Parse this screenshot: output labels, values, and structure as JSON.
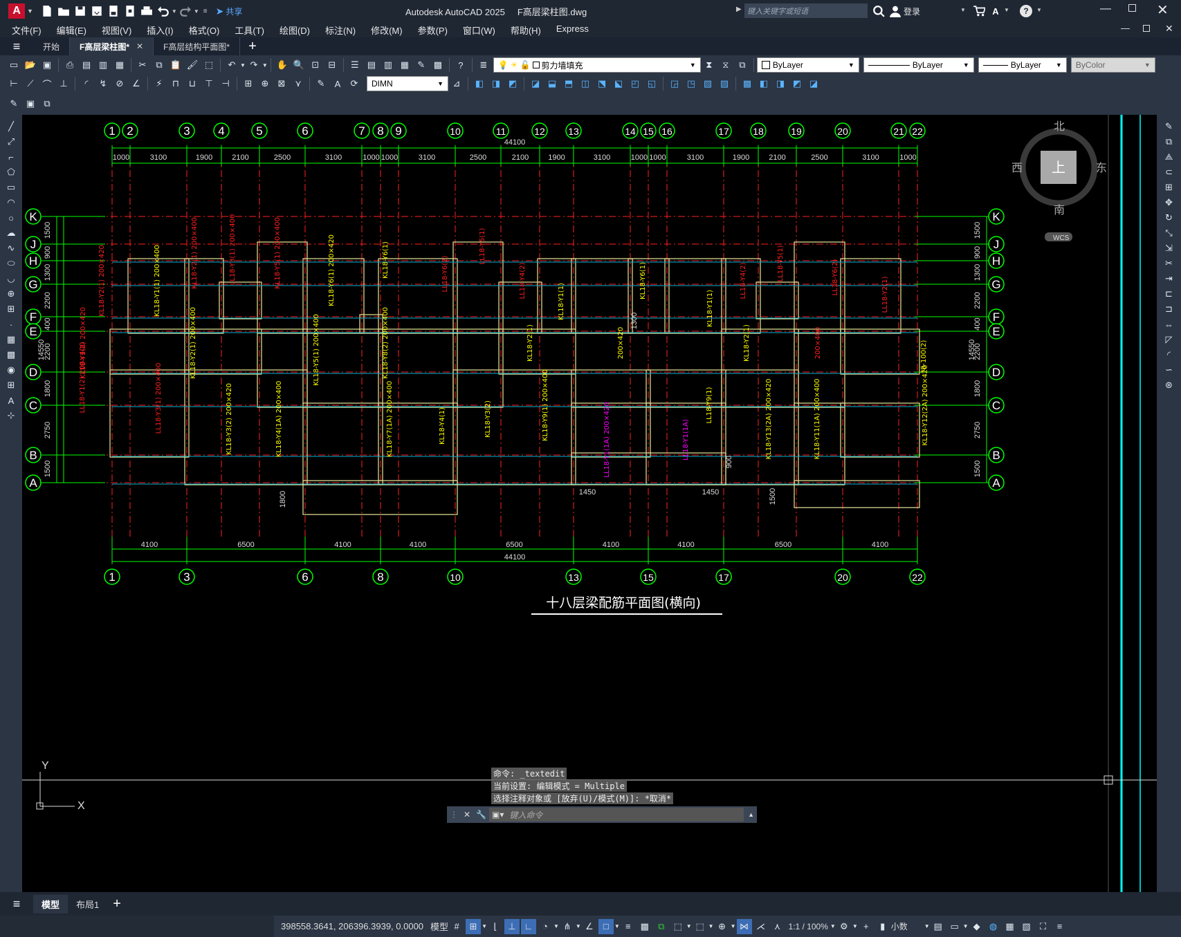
{
  "app": {
    "logo": "A",
    "share_label": "共享",
    "title": "Autodesk AutoCAD 2025",
    "filename": "F高层梁柱图.dwg",
    "search_placeholder": "键入关键字或短语",
    "login_label": "登录"
  },
  "menu": [
    "文件(F)",
    "编辑(E)",
    "视图(V)",
    "插入(I)",
    "格式(O)",
    "工具(T)",
    "绘图(D)",
    "标注(N)",
    "修改(M)",
    "参数(P)",
    "窗口(W)",
    "帮助(H)",
    "Express"
  ],
  "tabs": [
    {
      "label": "开始",
      "active": false
    },
    {
      "label": "F高层梁柱图*",
      "active": true
    },
    {
      "label": "F高层结构平面图*",
      "active": false
    }
  ],
  "toolbar": {
    "layer_name": "剪力墙填充",
    "color": "ByLayer",
    "linetype": "ByLayer",
    "lineweight": "ByLayer",
    "plotstyle": "ByColor",
    "dimstyle": "DIMN"
  },
  "viewcube": {
    "north": "北",
    "south": "南",
    "east": "东",
    "west": "西",
    "top": "上",
    "wcs": "WCS"
  },
  "drawing": {
    "title": "十八层梁配筋平面图(横向)",
    "top_axes": [
      "1",
      "2",
      "3",
      "4",
      "5",
      "6",
      "7",
      "8",
      "9",
      "10",
      "11",
      "12",
      "13",
      "14",
      "15",
      "16",
      "17",
      "18",
      "19",
      "20",
      "21",
      "22"
    ],
    "bottom_axes": [
      "1",
      "3",
      "6",
      "8",
      "10",
      "13",
      "15",
      "17",
      "20",
      "22"
    ],
    "row_axes": [
      "K",
      "J",
      "H",
      "G",
      "F",
      "E",
      "D",
      "C",
      "B",
      "A"
    ],
    "top_dims": [
      "1000",
      "3100",
      "1900",
      "2100",
      "2500",
      "3100",
      "1000",
      "1000",
      "3100",
      "2500",
      "2100",
      "1900",
      "3100",
      "1000",
      "1000",
      "3100",
      "1900",
      "2100",
      "2500",
      "3100",
      "1000"
    ],
    "bottom_dims": [
      "4100",
      "6500",
      "4100",
      "4100",
      "6500",
      "4100",
      "4100",
      "6500",
      "4100"
    ],
    "total_dim": "44100",
    "left_dims": [
      "1500",
      "900",
      "1300",
      "2200",
      "400",
      "2200",
      "1800",
      "2750",
      "1500"
    ],
    "right_dims": [
      "1500",
      "900",
      "1300",
      "2200",
      "400",
      "2200",
      "1800",
      "2750",
      "1500"
    ],
    "side_total": "14550",
    "extra_dims": [
      "1800",
      "1450",
      "1450",
      "1500",
      "900",
      "1300"
    ]
  },
  "command": {
    "history": [
      "命令: _textedit",
      "当前设置: 编辑模式 = Multiple",
      "选择注释对象或 [放弃(U)/模式(M)]: *取消*"
    ],
    "placeholder": "键入命令"
  },
  "layout_tabs": [
    "模型",
    "布局1"
  ],
  "status": {
    "coords": "398558.3641, 206396.3939, 0.0000",
    "space": "模型",
    "scale": "1:1 / 100%",
    "units": "小数"
  },
  "ucs": {
    "x": "X",
    "y": "Y"
  }
}
